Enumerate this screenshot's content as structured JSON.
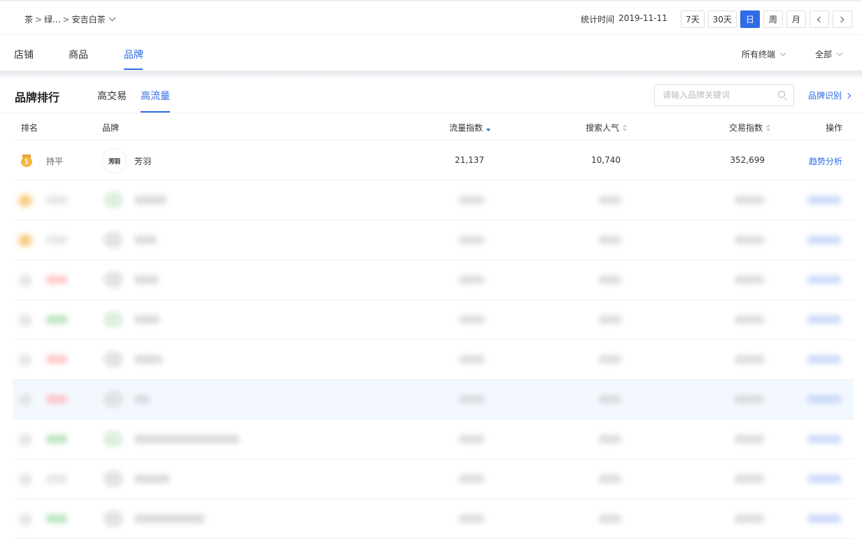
{
  "breadcrumb": {
    "item1": "茶",
    "sep1": ">",
    "item2": "绿...",
    "sep2": ">",
    "item3": "安吉白茶"
  },
  "stat_time": {
    "label": "统计时间",
    "value": "2019-11-11"
  },
  "period_buttons": [
    "7天",
    "30天",
    "日",
    "周",
    "月"
  ],
  "period_active": "日",
  "nav_tabs": [
    "店铺",
    "商品",
    "品牌"
  ],
  "nav_active": "品牌",
  "filters": {
    "terminal": "所有终端",
    "scope": "全部"
  },
  "ranking": {
    "title": "品牌排行",
    "subtabs": [
      "高交易",
      "高流量"
    ],
    "active_subtab": "高流量",
    "search_placeholder": "请输入品牌关键词",
    "brand_recognition_label": "品牌识别"
  },
  "table": {
    "columns": [
      "排名",
      "品牌",
      "流量指数",
      "搜索人气",
      "交易指数",
      "操作"
    ],
    "sorted_column": "流量指数",
    "rows": [
      {
        "rank": "1",
        "change": "持平",
        "brand": "芳羽",
        "logo_text": "芳羽",
        "traffic_index": "21,137",
        "search_popularity": "10,740",
        "trade_index": "352,699",
        "action": "趋势分析"
      }
    ]
  },
  "colors": {
    "accent": "#2f6ce5",
    "medal_gold": "#f5b83d"
  }
}
